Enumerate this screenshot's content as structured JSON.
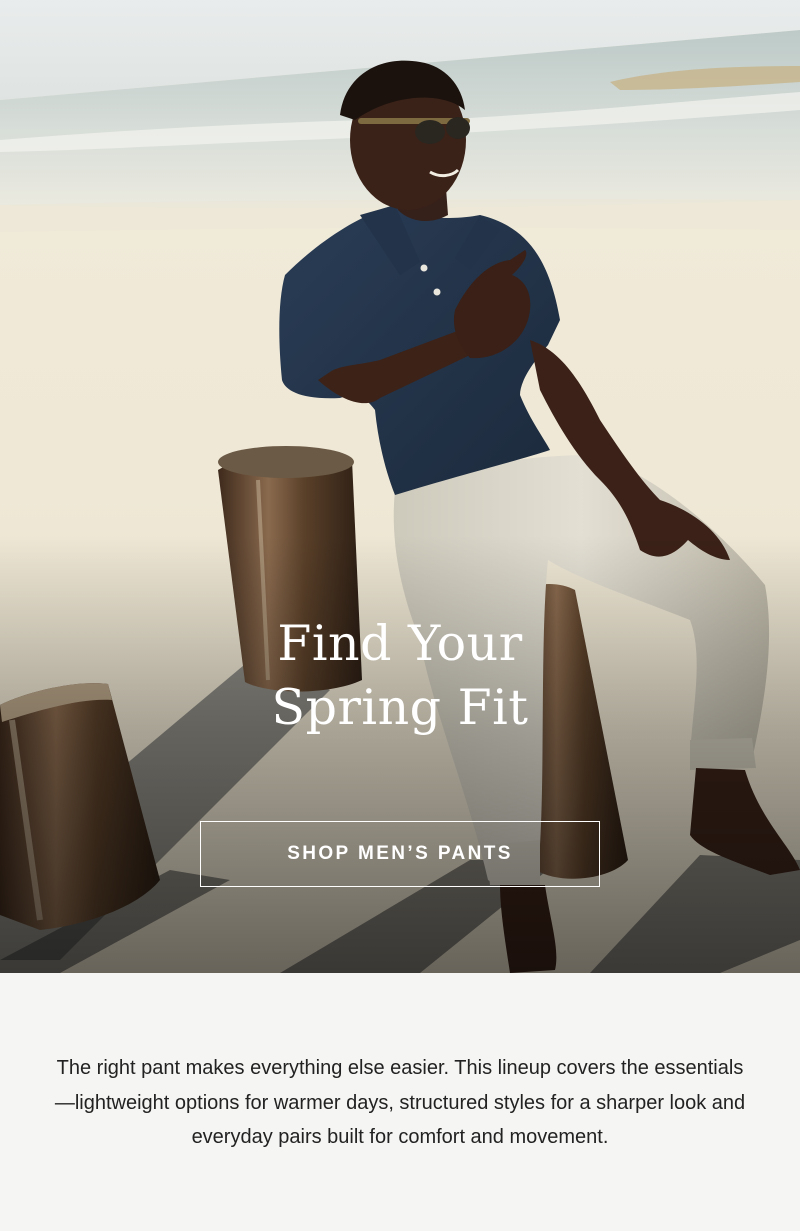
{
  "hero": {
    "image_alt": "Man in navy polo and stone pants sitting on a wooden post on the beach",
    "title_line1": "Find Your",
    "title_line2": "Spring Fit",
    "cta_label": "SHOP MEN’S PANTS"
  },
  "intro": {
    "text": "The right pant makes everything else easier. This lineup covers the essentials—lightweight options for warmer days, structured styles for a sharper look and everyday pairs built for comfort and movement."
  }
}
